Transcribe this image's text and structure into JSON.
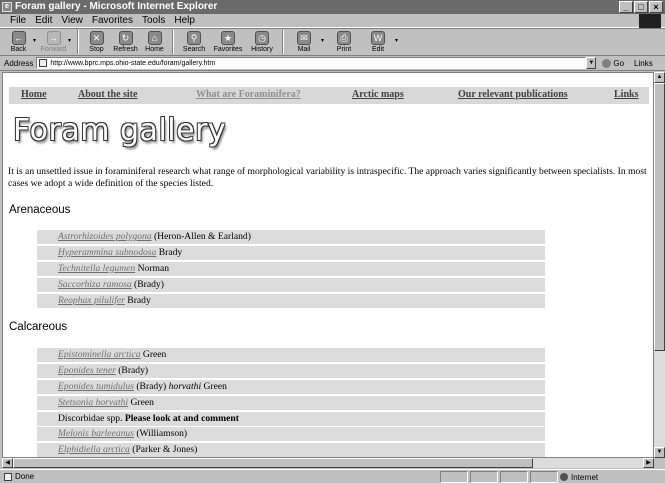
{
  "window": {
    "title": "Foram gallery - Microsoft Internet Explorer",
    "app_icon": "e",
    "controls": [
      "_",
      "□",
      "×"
    ]
  },
  "menu": [
    "File",
    "Edit",
    "View",
    "Favorites",
    "Tools",
    "Help"
  ],
  "toolbar": {
    "buttons": [
      {
        "label": "Back",
        "icon": "back-arrow-icon",
        "glyph": "←",
        "disabled": false
      },
      {
        "label": "Forward",
        "icon": "forward-arrow-icon",
        "glyph": "→",
        "disabled": true
      },
      {
        "label": "Stop",
        "icon": "stop-icon",
        "glyph": "✕",
        "disabled": false
      },
      {
        "label": "Refresh",
        "icon": "refresh-icon",
        "glyph": "↻",
        "disabled": false
      },
      {
        "label": "Home",
        "icon": "home-icon",
        "glyph": "⌂",
        "disabled": false
      },
      {
        "label": "Search",
        "icon": "search-icon",
        "glyph": "⚲",
        "disabled": false
      },
      {
        "label": "Favorites",
        "icon": "favorites-icon",
        "glyph": "★",
        "disabled": false
      },
      {
        "label": "History",
        "icon": "history-icon",
        "glyph": "◷",
        "disabled": false
      },
      {
        "label": "Mail",
        "icon": "mail-icon",
        "glyph": "✉",
        "disabled": false
      },
      {
        "label": "Print",
        "icon": "print-icon",
        "glyph": "⎙",
        "disabled": false
      },
      {
        "label": "Edit",
        "icon": "edit-icon",
        "glyph": "W",
        "disabled": false
      }
    ]
  },
  "address": {
    "label": "Address",
    "url": "http://www.bprc.mps.ohio-state.edu/foram/gallery.htm",
    "go_label": "Go",
    "links_label": "Links"
  },
  "nav": [
    {
      "label": "Home",
      "faded": false
    },
    {
      "label": "About the site",
      "faded": false
    },
    {
      "label": "What are Foraminifera?",
      "faded": true
    },
    {
      "label": "Arctic maps",
      "faded": false
    },
    {
      "label": "Our relevant publications",
      "faded": false
    },
    {
      "label": "Links",
      "faded": false
    }
  ],
  "page": {
    "title": "Foram gallery",
    "intro": "It is an unsettled issue in foraminiferal research what range of morphological variability is intraspecific. The approach varies significantly between specialists. In most cases we adopt a wide definition of the species listed.",
    "sections": [
      {
        "heading": "Arenaceous",
        "species": [
          {
            "name": "Astrorhizoides polygona",
            "rest": " (Heron-Allen & Earland)",
            "ital": "",
            "tail": ""
          },
          {
            "name": "Hyperammina subnodosa",
            "rest": " Brady",
            "ital": "",
            "tail": ""
          },
          {
            "name": "Technitella legumen",
            "rest": " Norman",
            "ital": "",
            "tail": ""
          },
          {
            "name": "Saccorhiza ramosa",
            "rest": " (Brady)",
            "ital": "",
            "tail": ""
          },
          {
            "name": "Reophax pilulifer",
            "rest": " Brady",
            "ital": "",
            "tail": ""
          }
        ]
      },
      {
        "heading": "Calcareous",
        "species": [
          {
            "name": "Epistominella arctica",
            "rest": " Green",
            "ital": "",
            "tail": ""
          },
          {
            "name": "Eponides tener",
            "rest": " (Brady)",
            "ital": "",
            "tail": ""
          },
          {
            "name": "Eponides tumidulus",
            "rest": " (Brady) ",
            "ital": "horvathi",
            "tail": " Green"
          },
          {
            "name": "Stetsonia horvathi",
            "rest": " Green",
            "ital": "",
            "tail": ""
          },
          {
            "name": "",
            "plain": "Discorbidae spp. ",
            "bold": "Please look at and comment",
            "rest": "",
            "ital": "",
            "tail": ""
          },
          {
            "name": "Melonis barleeanus",
            "rest": " (Williamson)",
            "ital": "",
            "tail": ""
          },
          {
            "name": "Elphidiella arctica",
            "rest": " (Parker & Jones)",
            "ital": "",
            "tail": ""
          }
        ]
      }
    ]
  },
  "status": {
    "text": "Done",
    "zone": "Internet"
  }
}
